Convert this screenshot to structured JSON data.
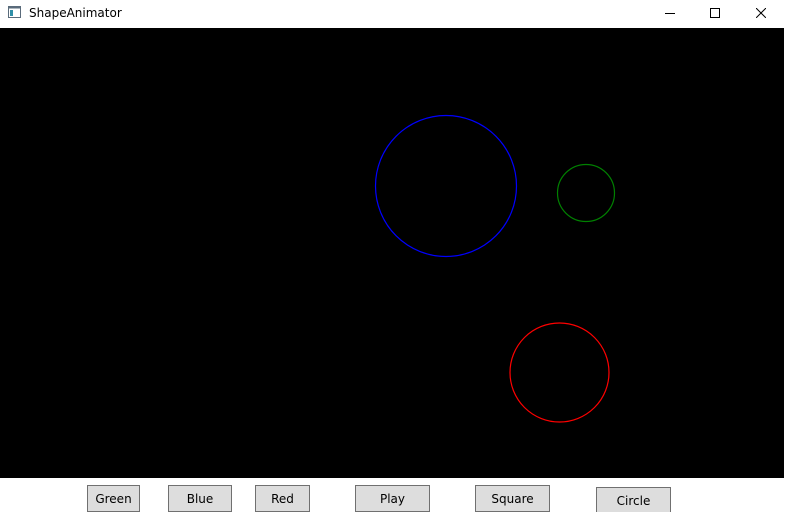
{
  "window": {
    "title": "ShapeAnimator",
    "minimize_icon": "minimize-icon",
    "maximize_icon": "maximize-icon",
    "close_icon": "close-icon"
  },
  "canvas": {
    "background": "#000000",
    "shapes": [
      {
        "name": "blue-circle",
        "color": "#0000ff"
      },
      {
        "name": "green-circle",
        "color": "#008000"
      },
      {
        "name": "red-circle",
        "color": "#ff0000"
      }
    ]
  },
  "toolbar": {
    "buttons": [
      {
        "label": "Green"
      },
      {
        "label": "Blue"
      },
      {
        "label": "Red"
      },
      {
        "label": "Play"
      },
      {
        "label": "Square"
      },
      {
        "label": "Circle"
      }
    ]
  }
}
